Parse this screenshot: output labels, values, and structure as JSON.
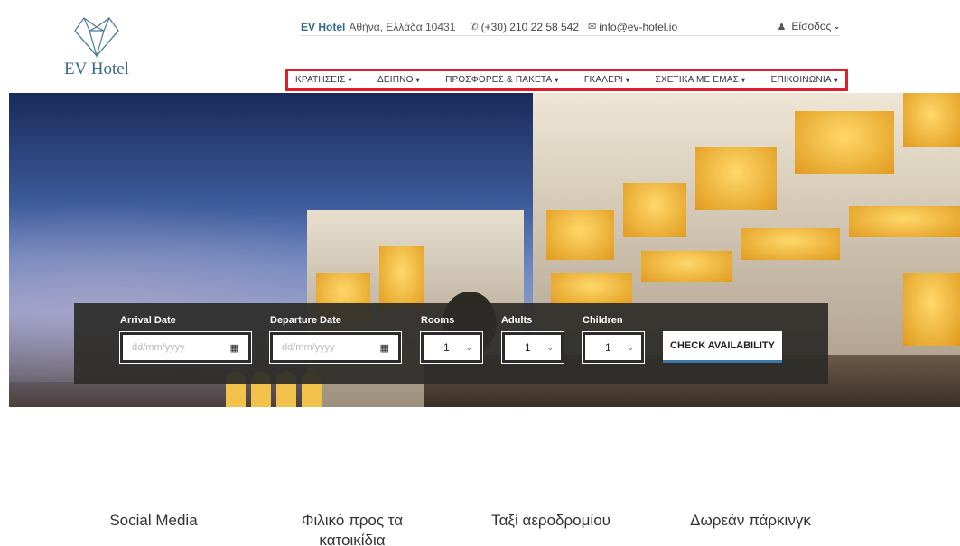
{
  "logo": {
    "text": "EV Hotel",
    "icon": "diamond-logo-icon"
  },
  "topbar": {
    "brand": "EV Hotel",
    "address": "Αθήνα, Ελλάδα 10431",
    "phone": "(+30) 210 22 58 542",
    "email": "info@ev-hotel.io",
    "login": "Είσοδος"
  },
  "nav": {
    "items": [
      {
        "label": "ΚΡΑΤΗΣΕΙΣ"
      },
      {
        "label": "ΔΕΙΠΝΟ"
      },
      {
        "label": "ΠΡΟΣΦΟΡΕΣ & ΠΑΚΕΤΑ"
      },
      {
        "label": "ΓΚΑΛΕΡΙ"
      },
      {
        "label": "ΣΧΕΤΙΚΑ ΜΕ ΕΜΑΣ"
      },
      {
        "label": "ΕΠΙΚΟΙΝΩΝΙΑ"
      }
    ],
    "highlight_color": "#e11d2a"
  },
  "booking": {
    "arrival_label": "Arrival Date",
    "arrival_placeholder": "dd/mm/yyyy",
    "departure_label": "Departure Date",
    "departure_placeholder": "dd/mm/yyyy",
    "rooms_label": "Rooms",
    "rooms_value": "1",
    "adults_label": "Adults",
    "adults_value": "1",
    "children_label": "Children",
    "children_value": "1",
    "button_label": "CHECK AVAILABILITY"
  },
  "features": [
    {
      "label": "Social Media"
    },
    {
      "label": "Φιλικό προς τα κατοικίδια"
    },
    {
      "label": "Ταξί αεροδρομίου"
    },
    {
      "label": "Δωρεάν πάρκινγκ"
    }
  ]
}
